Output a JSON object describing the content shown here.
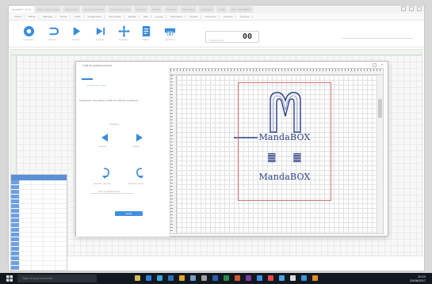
{
  "window": {
    "tabs": [
      "MandaBOX - Dodu",
      "Dodu - Accès rapide",
      "Ressources",
      "Ouvrir mes fichiers",
      "Conception simple",
      "Nouveau",
      "Fenêtre",
      "Dossiers",
      "Paramètres",
      "Navigateur",
      "Outils",
      "Aide - MandaBOX"
    ],
    "menu": [
      "Fichier",
      "Édition",
      "Affichage",
      "Dessin",
      "Outils",
      "Configuration",
      "Commande",
      "Module",
      "Aide",
      "Langue",
      "Paramètres",
      "Fenêtre",
      "Connexion",
      "Imprimer",
      "À propos"
    ]
  },
  "toolbar": {
    "buttons": [
      {
        "label": "Connecter",
        "icon": "connect-icon"
      },
      {
        "label": "Retour",
        "icon": "undo-icon"
      },
      {
        "label": "Lancer",
        "icon": "play-icon"
      },
      {
        "label": "Avancer",
        "icon": "step-icon"
      },
      {
        "label": "Déplacer",
        "icon": "move-icon"
      },
      {
        "label": "Fichier",
        "icon": "document-icon"
      },
      {
        "label": "Imprimer",
        "icon": "printer-icon"
      }
    ],
    "readout_caption": "Temps estimé",
    "readout_value": "00"
  },
  "dialog": {
    "title": "Outil de positionnement",
    "sublink": "Position de l'objet",
    "instruction": "Positionnez votre dessin à l'aide des flèches ci-dessous",
    "caption_move": "Déplacer",
    "left_label": "Gauche",
    "right_label": "Droite",
    "rotate_left_label": "Rotation gauche",
    "rotate_right_label": "Rotation droite",
    "slider_caption": "Pas de déplacement",
    "confirm_label": "Valider",
    "close_glyph": "×"
  },
  "design": {
    "brand_text_top": "MandaBOX",
    "brand_text_bottom": "MandaBOX",
    "glyph_left": "䷀",
    "glyph_right": "䷀",
    "stroke_color": "#2c3f8a",
    "frame_color": "#d27878"
  },
  "taskbar": {
    "search_placeholder": "Taper ici pour rechercher",
    "time": "10:24",
    "date": "20/06/2017",
    "icons": [
      "file-explorer-icon",
      "edge-icon",
      "store-icon",
      "mail-icon",
      "chrome-icon",
      "photos-icon",
      "settings-icon",
      "word-icon",
      "excel-icon",
      "powerpoint-icon",
      "onenote-icon",
      "app-icon",
      "app-icon",
      "app-icon",
      "app-icon",
      "app-icon",
      "app-icon"
    ]
  },
  "colors": {
    "accent": "#3f8fe0",
    "sheet_header": "#5b8fd6",
    "ruler_green": "#eef4ee",
    "taskbar": "#111820"
  }
}
